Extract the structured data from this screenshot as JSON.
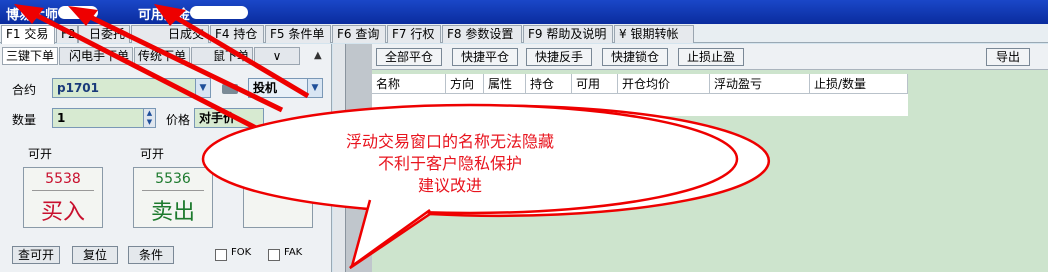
{
  "titlebar": {
    "app_name": "博易大师",
    "funds_label": "可用资金"
  },
  "main_tabs": [
    {
      "label": "F1 交易"
    },
    {
      "label": "F2"
    },
    {
      "label": "日委托"
    },
    {
      "label": "日成交"
    },
    {
      "label": "F4 持仓"
    },
    {
      "label": "F5 条件单"
    },
    {
      "label": "F6 查询"
    },
    {
      "label": "F7 行权"
    },
    {
      "label": "F8 参数设置"
    },
    {
      "label": "F9 帮助及说明"
    },
    {
      "label": "¥ 银期转帐"
    }
  ],
  "order_tabs": [
    {
      "label": "三键下单"
    },
    {
      "label": "闪电手下单"
    },
    {
      "label": "传统下单"
    },
    {
      "label": "鼠下单"
    },
    {
      "label": "∨"
    }
  ],
  "order_form": {
    "contract_label": "合约",
    "contract_value": "p1701",
    "hedge_value": "投机",
    "qty_label": "数量",
    "qty_value": "1",
    "price_label": "价格",
    "price_value": "对手价",
    "buy_avail_label": "可开",
    "sell_avail_label": "可开",
    "buy_price": "5538",
    "buy_label": "买入",
    "sell_price": "5536",
    "sell_label": "卖出",
    "query_button": "查可开",
    "reset_button": "复位",
    "condition_button": "条件",
    "fok_label": "FOK",
    "fak_label": "FAK"
  },
  "position_toolbar": {
    "close_all": "全部平仓",
    "quick_close": "快捷平仓",
    "quick_reverse": "快捷反手",
    "quick_lock": "快捷锁仓",
    "stop_loss_profit": "止损止盈",
    "export": "导出"
  },
  "position_table": {
    "headers": [
      "名称",
      "方向",
      "属性",
      "持仓",
      "可用",
      "开仓均价",
      "浮动盈亏",
      "止损/数量"
    ]
  },
  "annotation": {
    "line1": "浮动交易窗口的名称无法隐藏",
    "line2": "不利于客户隐私保护",
    "line3": "建议改进"
  },
  "colors": {
    "annotation_red": "#e8141e",
    "titlebar_blue": "#0a2c9e",
    "buy_red": "#c8102e",
    "sell_green": "#1d7a2e"
  }
}
